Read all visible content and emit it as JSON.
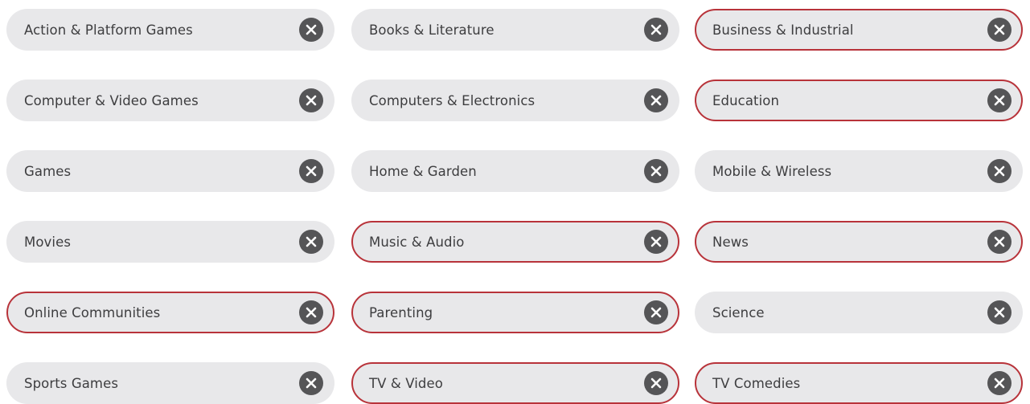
{
  "colors": {
    "chip_background": "#e8e8ea",
    "selected_border": "#b8333a",
    "remove_icon_background": "#555557",
    "label_text": "#3d3d3f"
  },
  "chips": [
    {
      "label": "Action & Platform Games",
      "selected": false
    },
    {
      "label": "Books & Literature",
      "selected": false
    },
    {
      "label": "Business & Industrial",
      "selected": true
    },
    {
      "label": "Computer & Video Games",
      "selected": false
    },
    {
      "label": "Computers & Electronics",
      "selected": false
    },
    {
      "label": "Education",
      "selected": true
    },
    {
      "label": "Games",
      "selected": false
    },
    {
      "label": "Home & Garden",
      "selected": false
    },
    {
      "label": "Mobile & Wireless",
      "selected": false
    },
    {
      "label": "Movies",
      "selected": false
    },
    {
      "label": "Music & Audio",
      "selected": true
    },
    {
      "label": "News",
      "selected": true
    },
    {
      "label": "Online Communities",
      "selected": true
    },
    {
      "label": "Parenting",
      "selected": true
    },
    {
      "label": "Science",
      "selected": false
    },
    {
      "label": "Sports Games",
      "selected": false
    },
    {
      "label": "TV & Video",
      "selected": true
    },
    {
      "label": "TV Comedies",
      "selected": true
    }
  ]
}
